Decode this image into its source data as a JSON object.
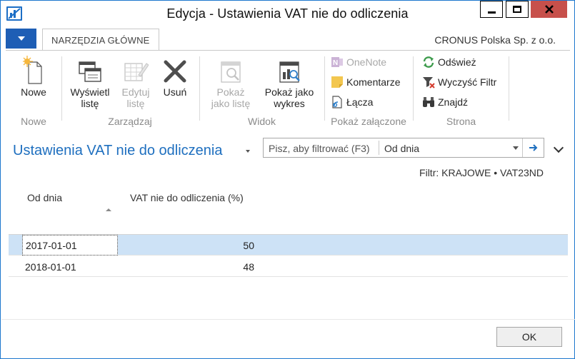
{
  "window": {
    "title": "Edycja - Ustawienia VAT nie do odliczenia"
  },
  "ribbon": {
    "tab_label": "NARZĘDZIA GŁÓWNE",
    "company": "CRONUS Polska Sp. z o.o.",
    "groups": {
      "nowe": {
        "label": "Nowe",
        "new_label": "Nowe"
      },
      "zarzadzaj": {
        "label": "Zarządzaj",
        "view_list_label": "Wyświetl\nlistę",
        "edit_list_label": "Edytuj\nlistę",
        "delete_label": "Usuń"
      },
      "widok": {
        "label": "Widok",
        "show_list_label": "Pokaż\njako listę",
        "show_chart_label": "Pokaż jako\nwykres"
      },
      "attached": {
        "label": "Pokaż załączone",
        "onenote_label": "OneNote",
        "comments_label": "Komentarze",
        "links_label": "Łącza"
      },
      "strona": {
        "label": "Strona",
        "refresh_label": "Odśwież",
        "clear_filter_label": "Wyczyść Filtr",
        "find_label": "Znajdź"
      }
    }
  },
  "page": {
    "title": "Ustawienia VAT nie do odliczenia",
    "search_placeholder": "Pisz, aby filtrować (F3)",
    "search_field": "Od dnia",
    "filter_text": "Filtr: KRAJOWE • VAT23ND"
  },
  "table": {
    "columns": [
      "Od dnia",
      "VAT nie do odliczenia (%)"
    ],
    "rows": [
      {
        "date": "2017-01-01",
        "value": "50"
      },
      {
        "date": "2018-01-01",
        "value": "48"
      }
    ]
  },
  "footer": {
    "ok_label": "OK"
  },
  "colors": {
    "accent": "#1e6fbf",
    "selected_row": "#cde2f6",
    "close_button": "#c7504b",
    "disabled_text": "#a8a8a8"
  }
}
